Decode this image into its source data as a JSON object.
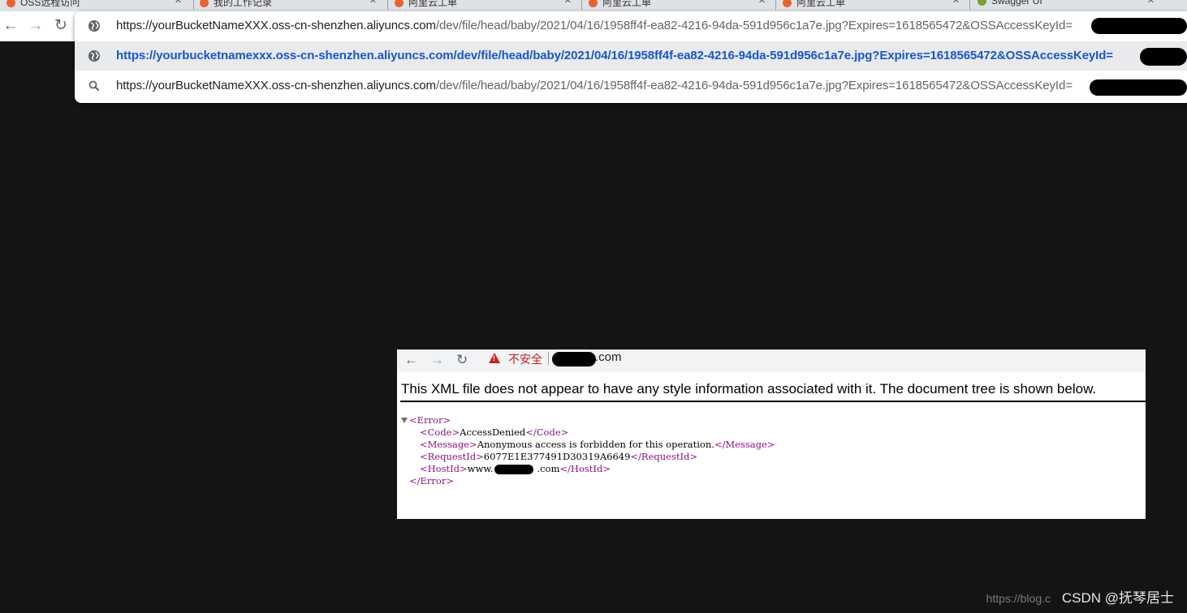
{
  "browser": {
    "tabs": [
      {
        "label": "OSS远程访问",
        "favicon": "csdn-icon"
      },
      {
        "label": "我的工作记录",
        "favicon": "csdn-icon"
      },
      {
        "label": "阿里云工单",
        "favicon": "csdn-icon"
      },
      {
        "label": "阿里云工单",
        "favicon": "csdn-icon"
      },
      {
        "label": "阿里云工单",
        "favicon": "csdn-icon"
      },
      {
        "label": "Swagger UI",
        "favicon": "swagger-icon"
      }
    ],
    "nav": {
      "back": "←",
      "forward": "→",
      "reload": "↻"
    }
  },
  "omnibox": {
    "suggestions": [
      {
        "host": "https://yourBucketNameXXX.oss-cn-shenzhen.aliyuncs.com",
        "path": "/dev/file/head/baby/2021/04/16/1958ff4f-ea82-4216-94da-591d956c1a7e.jpg?Expires=1618565472&OSSAccessKeyId=",
        "icon": "globe-icon"
      },
      {
        "host": "https://yourbucketnamexxx.oss-cn-shenzhen.aliyuncs.com",
        "path": "/dev/file/head/baby/2021/04/16/1958ff4f-ea82-4216-94da-591d956c1a7e.jpg?Expires=1618565472&OSSAccessKeyId=",
        "icon": "globe-icon"
      },
      {
        "host": "https://yourBucketNameXXX.oss-cn-shenzhen.aliyuncs.com",
        "path": "/dev/file/head/baby/2021/04/16/1958ff4f-ea82-4216-94da-591d956c1a7e.jpg?Expires=1618565472&OSSAccessKeyId=",
        "icon": "search-icon"
      }
    ]
  },
  "inner_page": {
    "nav": {
      "back": "←",
      "forward": "→",
      "reload": "↻"
    },
    "security_label": "不安全",
    "url_suffix": ".com",
    "notice": "This XML file does not appear to have any style information associated with it. The document tree is shown below.",
    "xml": {
      "root_open": "<Error>",
      "root_close": "</Error>",
      "code_open": "<Code>",
      "code_value": "AccessDenied",
      "code_close": "</Code>",
      "message_open": "<Message>",
      "message_value": "Anonymous access is forbidden for this operation.",
      "message_close": "</Message>",
      "requestid_open": "<RequestId>",
      "requestid_value": "6077E1E377491D30319A6649",
      "requestid_close": "</RequestId>",
      "hostid_open": "<HostId>",
      "hostid_prefix": "www.",
      "hostid_suffix": ".com",
      "hostid_close": "</HostId>"
    }
  },
  "watermark": {
    "faint": "https://blog.c",
    "label": "CSDN @抚琴居士"
  }
}
